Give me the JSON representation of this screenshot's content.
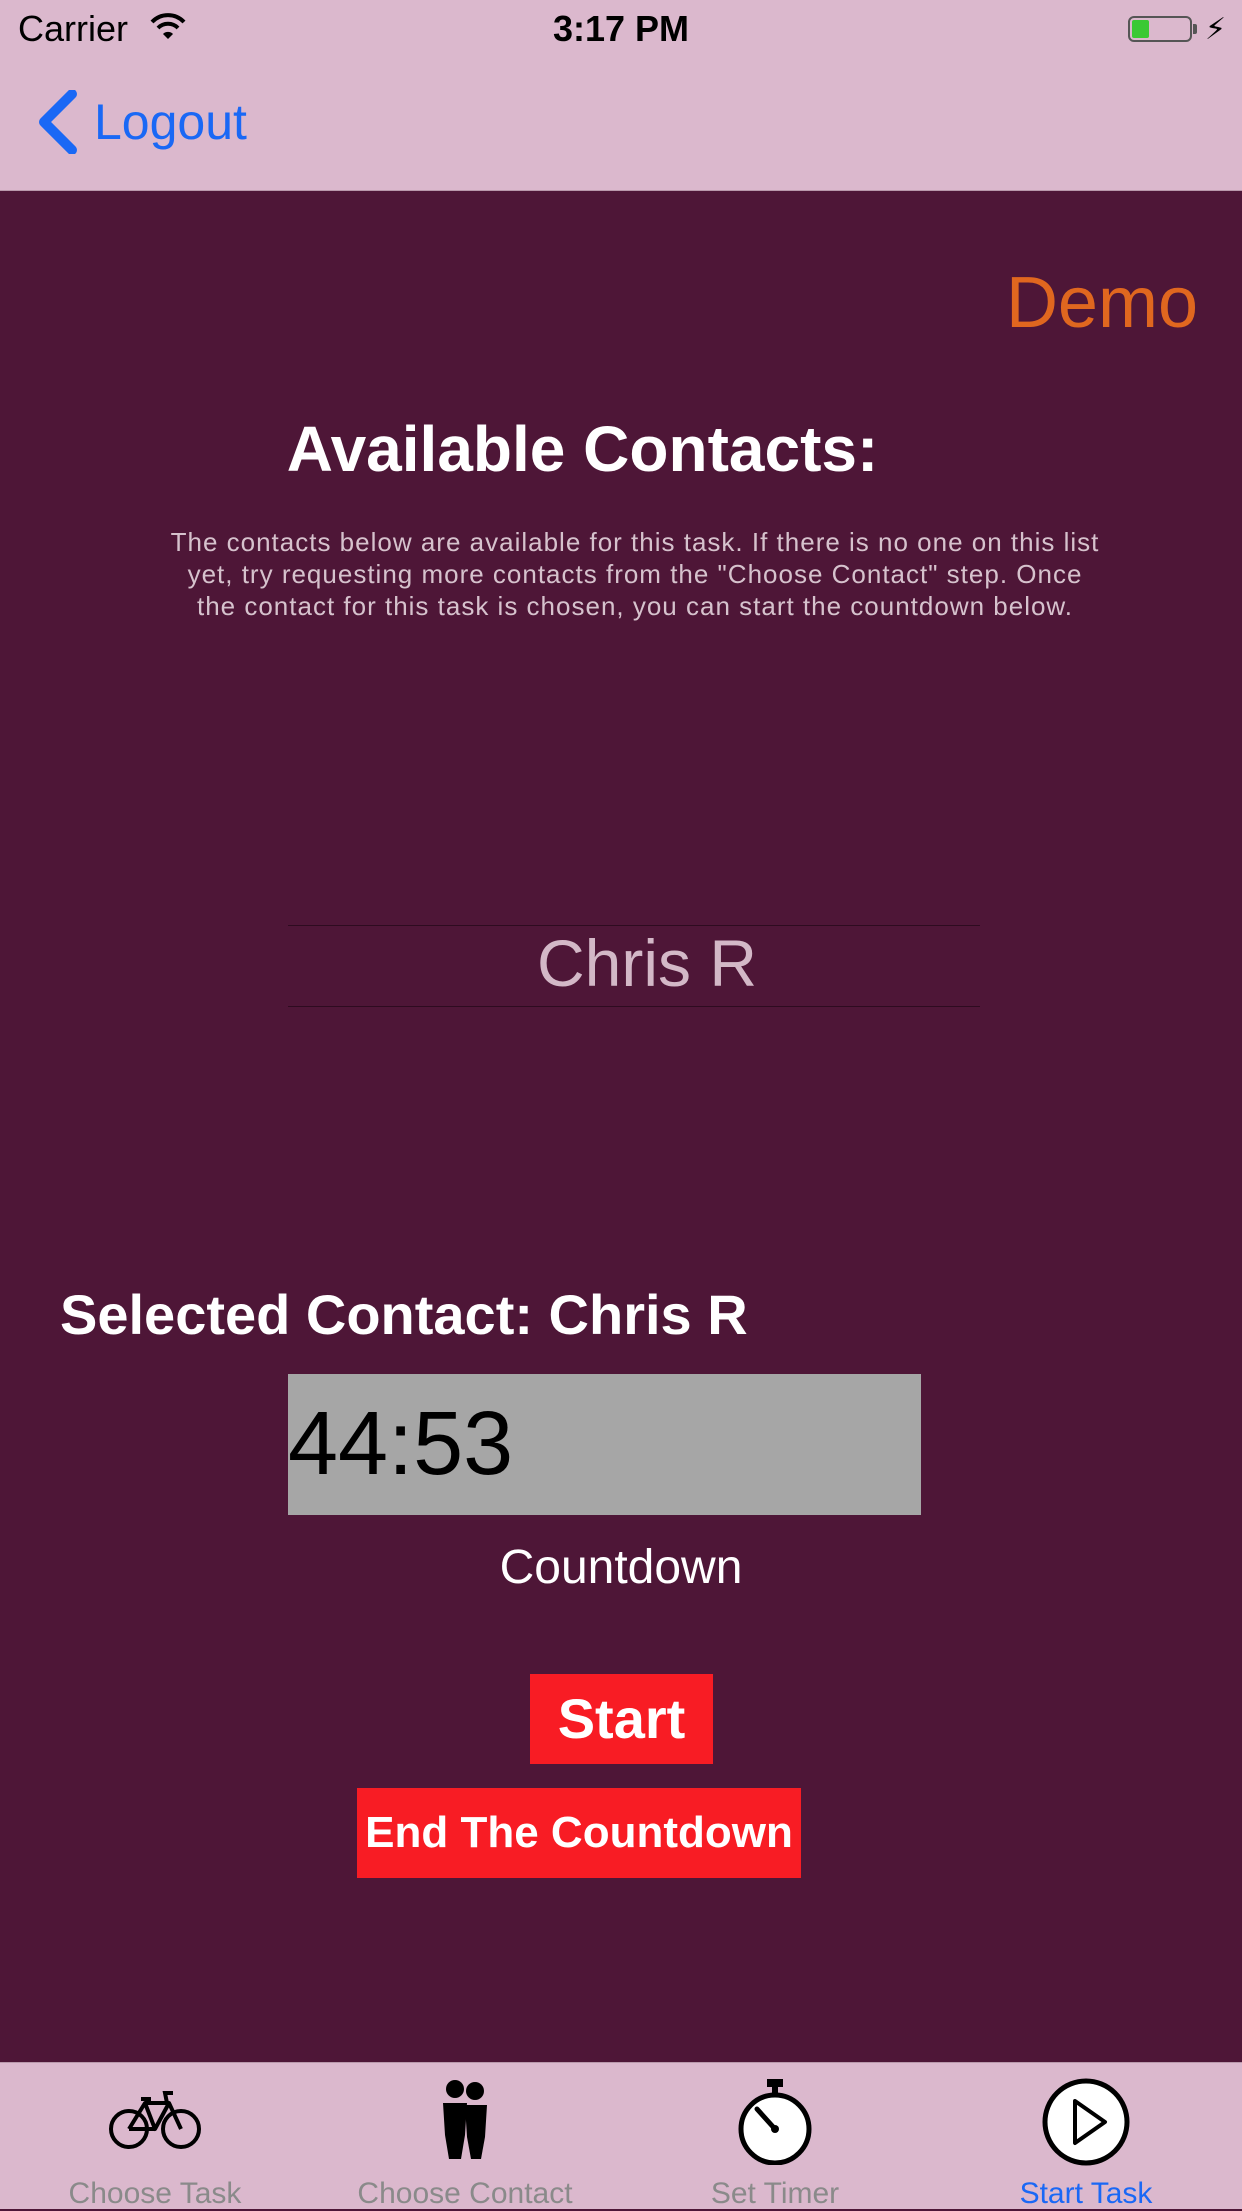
{
  "status_bar": {
    "carrier": "Carrier",
    "time": "3:17 PM",
    "battery_level": 0.3
  },
  "nav": {
    "back_label": "Logout"
  },
  "main": {
    "demo_label": "Demo",
    "title": "Available Contacts:",
    "description": "The contacts below are available for this task. If there is no one on this list yet, try requesting more contacts from the \"Choose Contact\" step. Once the contact for this task is chosen, you can start the countdown below.",
    "picker_selected": "Chris R",
    "selected_contact": "Selected Contact: Chris R",
    "timer_value": "44:53",
    "countdown_label": "Countdown",
    "start_button": "Start",
    "end_button": "End The Countdown"
  },
  "tabs": [
    {
      "label": "Choose Task",
      "icon": "bicycle-icon",
      "active": false
    },
    {
      "label": "Choose Contact",
      "icon": "people-icon",
      "active": false
    },
    {
      "label": "Set Timer",
      "icon": "stopwatch-icon",
      "active": false
    },
    {
      "label": "Start Task",
      "icon": "play-icon",
      "active": true
    }
  ],
  "colors": {
    "background": "#4e1637",
    "bars": "#dbb8cd",
    "accent_blue": "#1a68f5",
    "demo_orange": "#e0671f",
    "button_red": "#f81c24"
  }
}
